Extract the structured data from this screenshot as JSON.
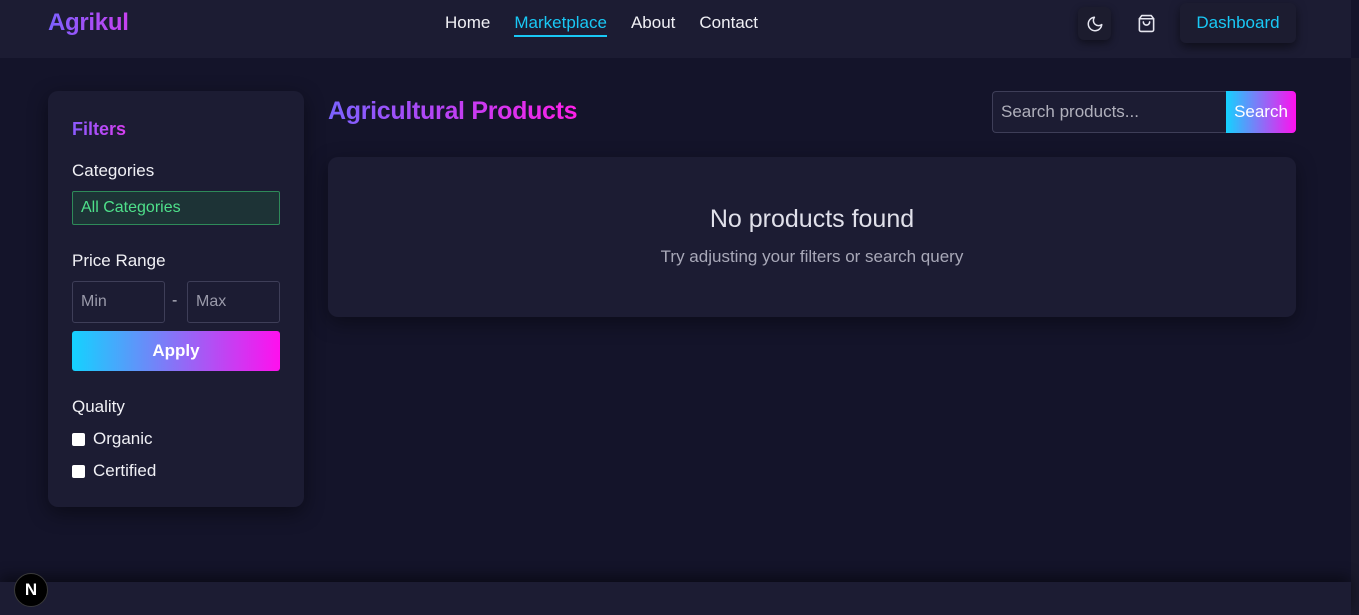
{
  "brand": {
    "name": "Agrikul"
  },
  "nav": {
    "links": [
      {
        "label": "Home",
        "active": false
      },
      {
        "label": "Marketplace",
        "active": true
      },
      {
        "label": "About",
        "active": false
      },
      {
        "label": "Contact",
        "active": false
      }
    ],
    "theme_icon": "moon-icon",
    "cart_icon": "shopping-bag-icon",
    "dashboard_label": "Dashboard"
  },
  "sidebar": {
    "title": "Filters",
    "categories_label": "Categories",
    "category_selected": "All Categories",
    "price_label": "Price Range",
    "min_placeholder": "Min",
    "max_placeholder": "Max",
    "separator": "-",
    "apply_label": "Apply",
    "quality_label": "Quality",
    "quality_options": [
      {
        "label": "Organic",
        "checked": false
      },
      {
        "label": "Certified",
        "checked": false
      }
    ]
  },
  "main": {
    "title": "Agricultural Products",
    "search_placeholder": "Search products...",
    "search_button": "Search",
    "empty_title": "No products found",
    "empty_subtitle": "Try adjusting your filters or search query"
  },
  "badge": {
    "letter": "N"
  },
  "colors": {
    "accent_cyan": "#19c8f5",
    "accent_magenta": "#ff10ee",
    "background": "#14142a",
    "surface": "#1c1c33"
  }
}
